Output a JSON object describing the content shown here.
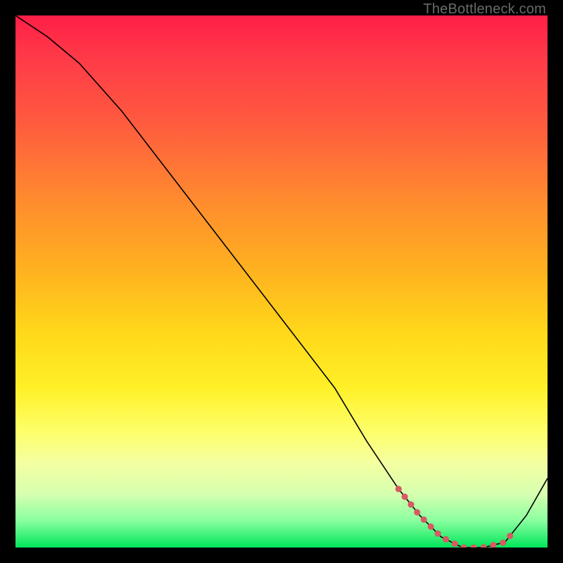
{
  "watermark": "TheBottleneck.com",
  "chart_data": {
    "type": "line",
    "title": "",
    "xlabel": "",
    "ylabel": "",
    "xlim": [
      0,
      100
    ],
    "ylim": [
      0,
      100
    ],
    "series": [
      {
        "name": "bottleneck-curve",
        "x": [
          0,
          6,
          12,
          20,
          30,
          40,
          50,
          60,
          66,
          72,
          76,
          80,
          84,
          88,
          92,
          96,
          100
        ],
        "y": [
          100,
          96,
          91,
          82,
          69,
          56,
          43,
          30,
          20,
          11,
          6,
          2,
          0,
          0,
          1,
          6,
          13
        ]
      }
    ],
    "highlight_region": {
      "name": "optimal-zone",
      "x_start": 72,
      "x_end": 94
    },
    "colors": {
      "curve": "#000000",
      "highlight_dots": "#d85a63",
      "gradient_top": "#ff1f47",
      "gradient_bottom": "#00e65a"
    }
  }
}
